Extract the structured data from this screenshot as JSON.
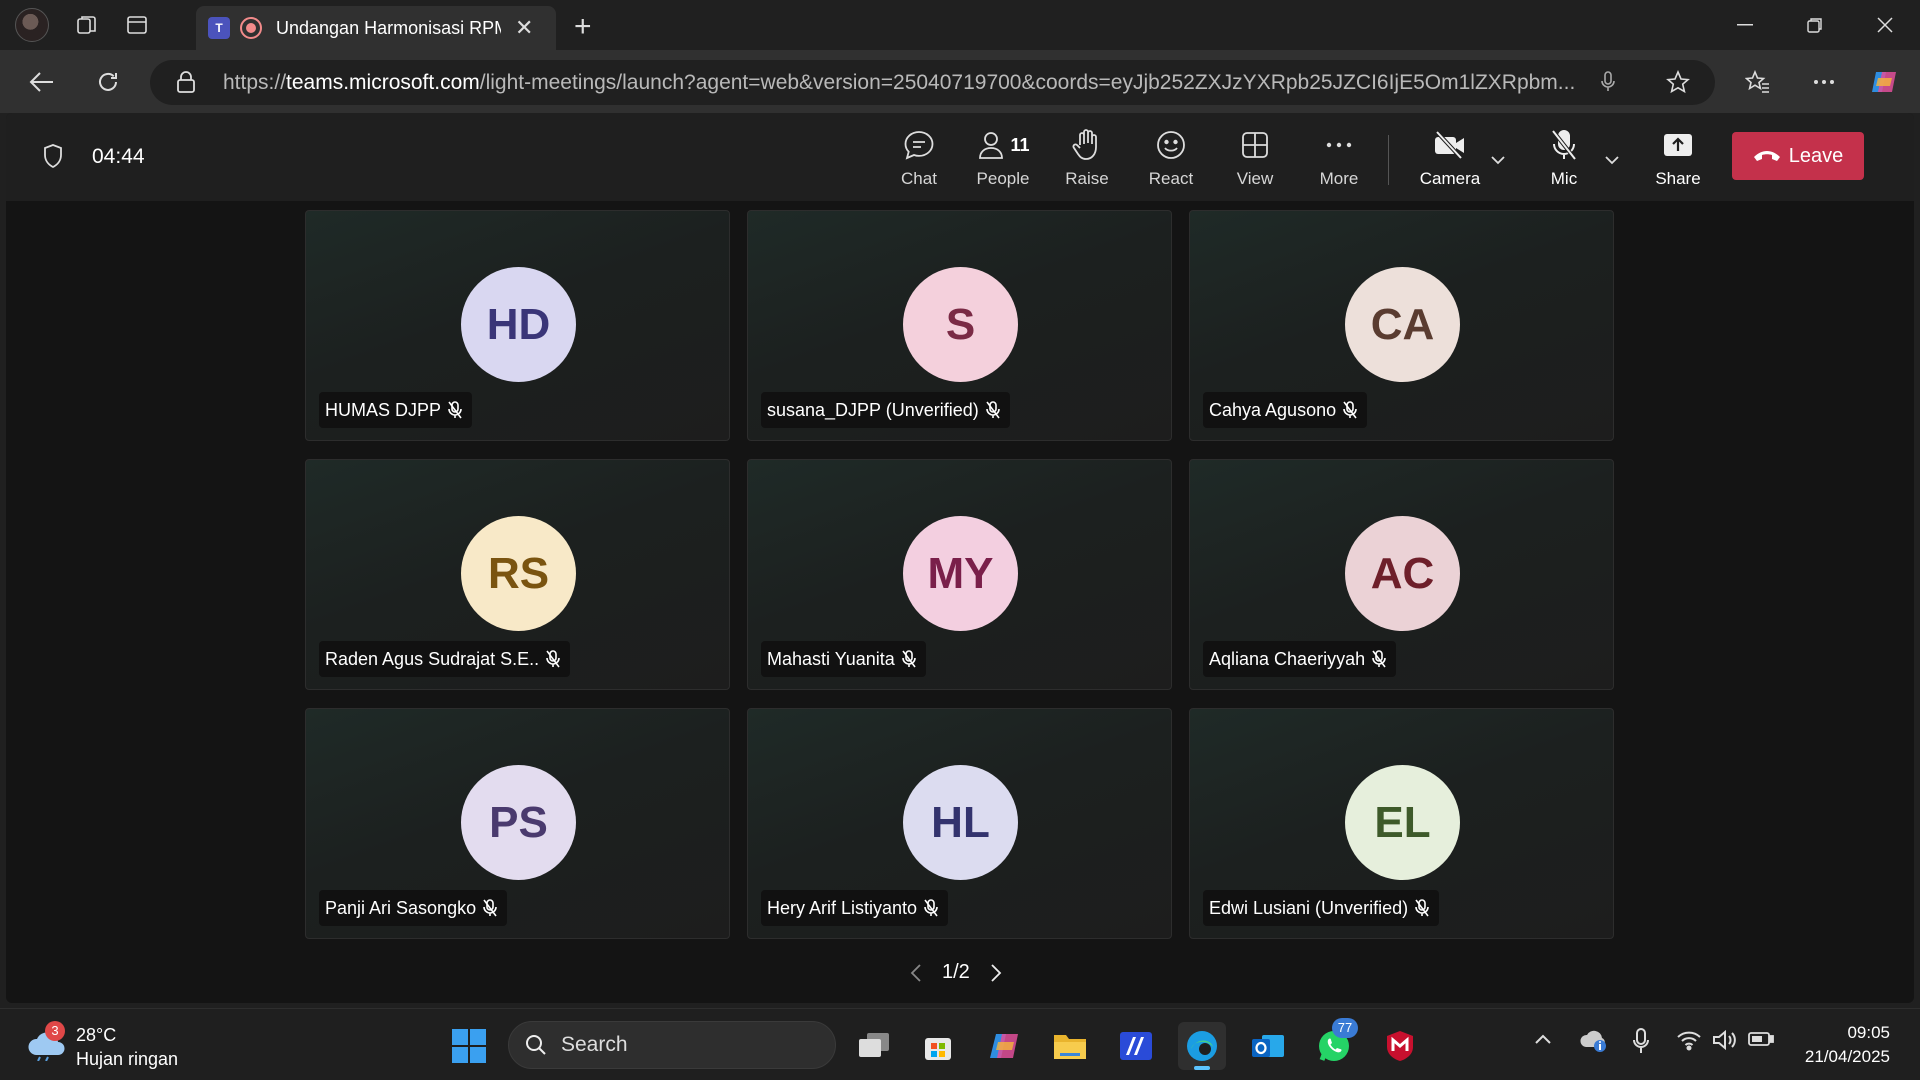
{
  "browser": {
    "tab_title": "Undangan Harmonisasi RPM",
    "tab_app_letter": "T",
    "url_prefix": "https://",
    "url_domain": "teams.microsoft.com",
    "url_rest": "/light-meetings/launch?agent=web&version=25040719700&coords=eyJjb252ZXJzYXRpb25JZCI6IjE5Om1lZXRpbm..."
  },
  "meeting": {
    "timer": "04:44",
    "people_count": "11",
    "toolbar": {
      "chat": "Chat",
      "people": "People",
      "raise": "Raise",
      "react": "React",
      "view": "View",
      "more": "More",
      "camera": "Camera",
      "mic": "Mic",
      "share": "Share",
      "leave": "Leave"
    },
    "participants": [
      {
        "initials": "HD",
        "name": "HUMAS DJPP",
        "avatar_bg": "#d9d7f1",
        "avatar_fg": "#3a3578"
      },
      {
        "initials": "S",
        "name": "susana_DJPP (Unverified)",
        "avatar_bg": "#f4d0dc",
        "avatar_fg": "#7a2a45"
      },
      {
        "initials": "CA",
        "name": "Cahya Agusono",
        "avatar_bg": "#ede0da",
        "avatar_fg": "#5a3c30"
      },
      {
        "initials": "RS",
        "name": "Raden Agus Sudrajat S.E..",
        "avatar_bg": "#f8e9c8",
        "avatar_fg": "#7a5410"
      },
      {
        "initials": "MY",
        "name": "Mahasti Yuanita",
        "avatar_bg": "#f3cfe0",
        "avatar_fg": "#7a1f4a"
      },
      {
        "initials": "AC",
        "name": "Aqliana Chaeriyyah",
        "avatar_bg": "#ebd2d6",
        "avatar_fg": "#6e1f2a"
      },
      {
        "initials": "PS",
        "name": "Panji Ari Sasongko",
        "avatar_bg": "#e3dcef",
        "avatar_fg": "#4a3a6e"
      },
      {
        "initials": "HL",
        "name": "Hery Arif Listiyanto",
        "avatar_bg": "#dcdcf0",
        "avatar_fg": "#33336e"
      },
      {
        "initials": "EL",
        "name": "Edwi Lusiani (Unverified)",
        "avatar_bg": "#e6efdc",
        "avatar_fg": "#3e5a2a"
      }
    ],
    "page_indicator": "1/2"
  },
  "taskbar": {
    "weather_badge": "3",
    "temperature": "28°C",
    "condition": "Hujan ringan",
    "search_placeholder": "Search",
    "whatsapp_badge": "77",
    "time": "09:05",
    "date": "21/04/2025"
  },
  "colors": {
    "leave": "#c4314b",
    "teams": "#4b53bc",
    "accent": "#5cc4ff"
  }
}
